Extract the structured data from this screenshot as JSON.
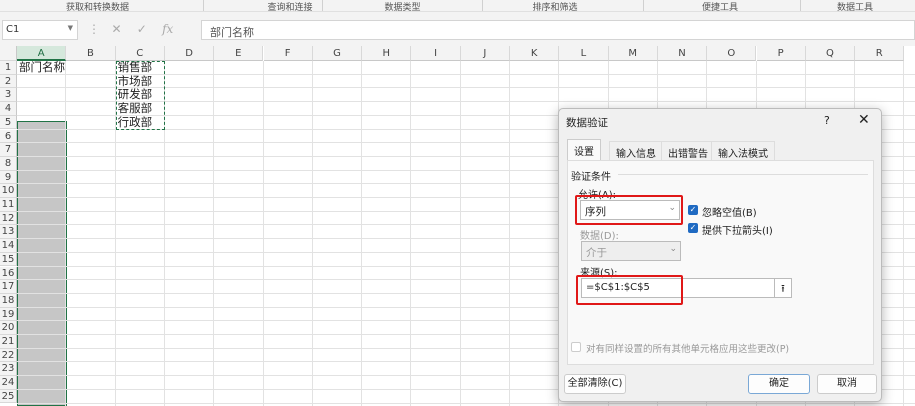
{
  "ribbon_groups": [
    "获取和转换数据",
    "查询和连接",
    "数据类型",
    "排序和筛选",
    "便捷工具",
    "数据工具"
  ],
  "formula_bar": {
    "name_box": "C1",
    "cancel_icon": "✕",
    "enter_icon": "✓",
    "fx_label": "fx",
    "formula": "部门名称"
  },
  "columns": [
    "A",
    "B",
    "C",
    "D",
    "E",
    "F",
    "G",
    "H",
    "I",
    "J",
    "K",
    "L",
    "M",
    "N",
    "O",
    "P",
    "Q",
    "R"
  ],
  "rows": [
    "1",
    "2",
    "3",
    "4",
    "5",
    "6",
    "7",
    "8",
    "9",
    "10",
    "11",
    "12",
    "13",
    "14",
    "15",
    "16",
    "17",
    "18",
    "19",
    "20",
    "21",
    "22",
    "23",
    "24",
    "25"
  ],
  "cells": {
    "A1": "部门名称",
    "C": [
      "销售部",
      "市场部",
      "研发部",
      "客服部",
      "行政部"
    ]
  },
  "dialog": {
    "title": "数据验证",
    "help": "?",
    "close": "✕",
    "tabs": [
      "设置",
      "输入信息",
      "出错警告",
      "输入法模式"
    ],
    "section": "验证条件",
    "allow_label": "允许(A):",
    "allow_value": "序列",
    "data_label": "数据(D):",
    "data_value": "介于",
    "ignore_blank": "忽略空值(B)",
    "dropdown_arrow": "提供下拉箭头(I)",
    "source_label": "来源(S):",
    "source_value": "=$C$1:$C$5",
    "apply_all": "对有同样设置的所有其他单元格应用这些更改(P)",
    "clear_all": "全部清除(C)",
    "ok": "确定",
    "cancel": "取消"
  }
}
